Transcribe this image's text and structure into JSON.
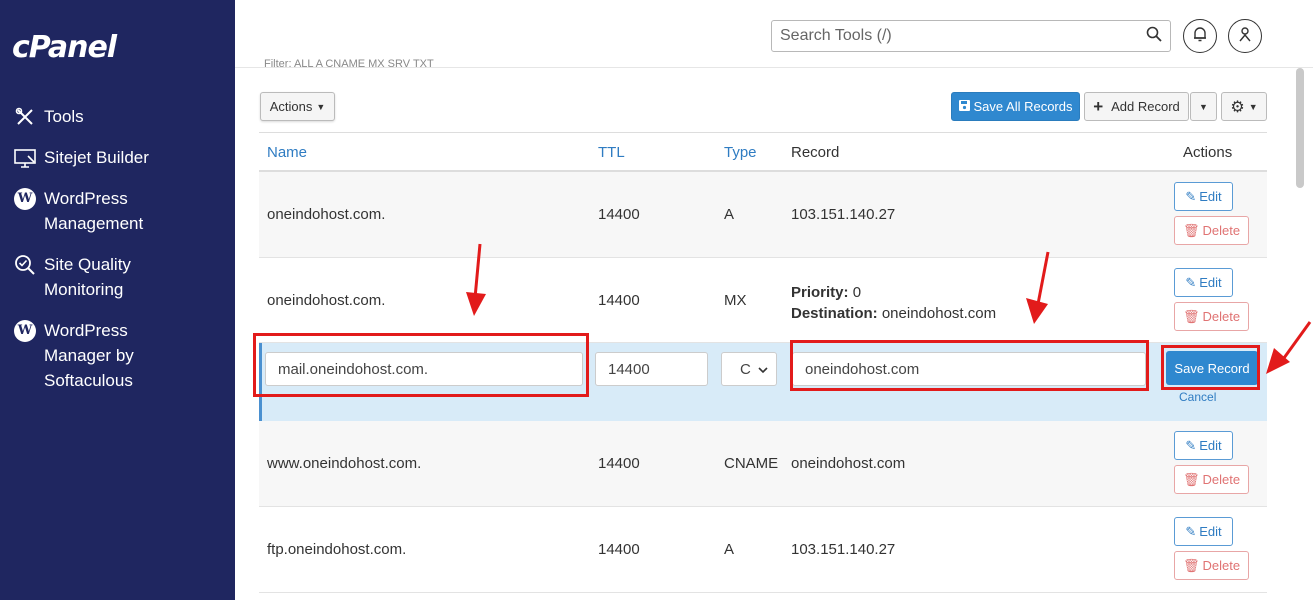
{
  "sidebar": {
    "logo": "cPanel",
    "items": [
      {
        "label": "Tools",
        "icon": "tools-icon"
      },
      {
        "label": "Sitejet Builder",
        "icon": "sitejet-icon"
      },
      {
        "label": "WordPress Management",
        "icon": "wordpress-icon"
      },
      {
        "label": "Site Quality Monitoring",
        "icon": "site-quality-icon"
      },
      {
        "label": "WordPress Manager by Softaculous",
        "icon": "wordpress-icon"
      }
    ]
  },
  "topbar": {
    "search_placeholder": "Search Tools (/)",
    "filter_text": "Filter: ALL A CNAME MX SRV TXT"
  },
  "toolbar": {
    "actions_label": "Actions",
    "save_all_label": "Save All Records",
    "add_record_label": "Add Record"
  },
  "table": {
    "headers": {
      "name": "Name",
      "ttl": "TTL",
      "type": "Type",
      "record": "Record",
      "actions": "Actions"
    },
    "rows": [
      {
        "name": "oneindohost.com.",
        "ttl": "14400",
        "type": "A",
        "record": "103.151.140.27"
      },
      {
        "name": "oneindohost.com.",
        "ttl": "14400",
        "type": "MX",
        "priority_label": "Priority:",
        "priority": "0",
        "destination_label": "Destination:",
        "destination": "oneindohost.com"
      },
      {
        "name": "www.oneindohost.com.",
        "ttl": "14400",
        "type": "CNAME",
        "record": "oneindohost.com"
      },
      {
        "name": "ftp.oneindohost.com.",
        "ttl": "14400",
        "type": "A",
        "record": "103.151.140.27"
      }
    ],
    "edit_label": "Edit",
    "delete_label": "Delete",
    "edit_row": {
      "name_value": "mail.oneindohost.com.",
      "ttl_value": "14400",
      "type_value": "C",
      "record_value": "oneindohost.com",
      "save_label": "Save Record",
      "cancel_label": "Cancel"
    }
  },
  "colors": {
    "sidebar": "#1f2660",
    "primary": "#2f88cf",
    "highlight": "#e21b1b",
    "edit_row": "#d8ebf8"
  }
}
